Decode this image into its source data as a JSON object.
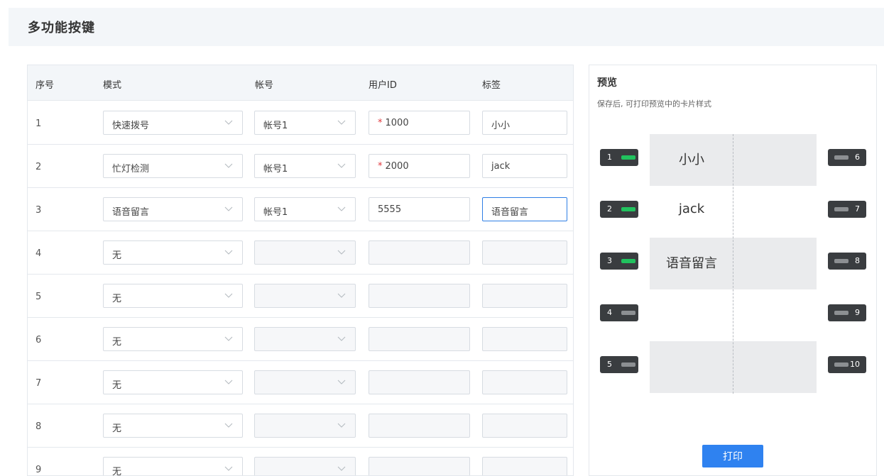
{
  "header": {
    "title": "多功能按键"
  },
  "table": {
    "columns": {
      "index": "序号",
      "mode": "模式",
      "account": "帐号",
      "user_id": "用户ID",
      "label": "标签"
    },
    "rows": [
      {
        "index": "1",
        "mode": "快速拨号",
        "account": "帐号1",
        "user_id": "1000",
        "required": true,
        "label": "小小"
      },
      {
        "index": "2",
        "mode": "忙灯检测",
        "account": "帐号1",
        "user_id": "2000",
        "required": true,
        "label": "jack"
      },
      {
        "index": "3",
        "mode": "语音留言",
        "account": "帐号1",
        "user_id": "5555",
        "required": false,
        "label": "语音留言",
        "focused": true
      },
      {
        "index": "4",
        "mode": "无",
        "account": "",
        "user_id": "",
        "label": ""
      },
      {
        "index": "5",
        "mode": "无",
        "account": "",
        "user_id": "",
        "label": ""
      },
      {
        "index": "6",
        "mode": "无",
        "account": "",
        "user_id": "",
        "label": ""
      },
      {
        "index": "7",
        "mode": "无",
        "account": "",
        "user_id": "",
        "label": ""
      },
      {
        "index": "8",
        "mode": "无",
        "account": "",
        "user_id": "",
        "label": ""
      },
      {
        "index": "9",
        "mode": "无",
        "account": "",
        "user_id": "",
        "label": ""
      }
    ]
  },
  "preview": {
    "title": "预览",
    "subtitle": "保存后, 可打印预览中的卡片样式",
    "card_labels": [
      "小小",
      "jack",
      "语音留言",
      "",
      ""
    ],
    "left_keys": [
      {
        "num": "1",
        "active": true
      },
      {
        "num": "2",
        "active": true
      },
      {
        "num": "3",
        "active": true
      },
      {
        "num": "4",
        "active": false
      },
      {
        "num": "5",
        "active": false
      }
    ],
    "right_keys": [
      {
        "num": "6",
        "active": false
      },
      {
        "num": "7",
        "active": false
      },
      {
        "num": "8",
        "active": false
      },
      {
        "num": "9",
        "active": false
      },
      {
        "num": "10",
        "active": false
      }
    ],
    "print_label": "打印"
  },
  "colors": {
    "accent": "#2f82f0",
    "led_on": "#21c25e",
    "required": "#e0393e",
    "header_bg": "#f3f6f9"
  }
}
